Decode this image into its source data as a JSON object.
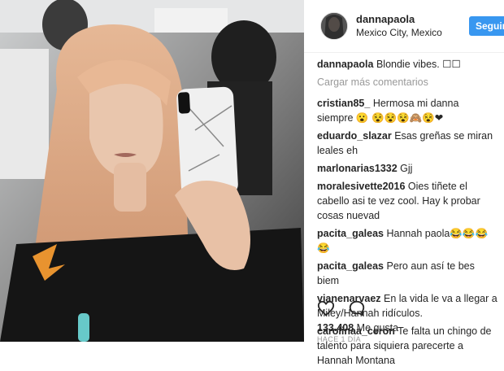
{
  "post": {
    "username": "dannapaola",
    "location": "Mexico City, Mexico",
    "follow_label": "Seguir"
  },
  "caption": {
    "username": "dannapaola",
    "text": "Blondie vibes. ☐☐"
  },
  "load_more_label": "Cargar más comentarios",
  "comments": [
    {
      "user": "cristian85_",
      "text": "Hermosa mi danna siempre 😮 😵😵😵🙈😵❤"
    },
    {
      "user": "eduardo_slazar",
      "text": "Esas greñas se miran leales eh"
    },
    {
      "user": "marlonarias1332",
      "text": "Gjj"
    },
    {
      "user": "moralesivette2016",
      "text": "Oies tiñete el cabello asi te vez cool. Hay k probar cosas nuevad"
    },
    {
      "user": "pacita_galeas",
      "text": "Hannah paola😂😂😂😂"
    },
    {
      "user": "pacita_galeas",
      "text": "Pero aun así te bes biem"
    },
    {
      "user": "vianenarvaez",
      "text": "En la vida le va a llegar a Miley/Hannah ridículos."
    },
    {
      "user": "carolinaa_ceron",
      "text": "Te falta un chingo de talento para siquiera parecerte a Hannah Montana"
    }
  ],
  "likes": {
    "count": "133.408",
    "label": "Me gusta"
  },
  "date": "HACE 1 DÍA",
  "icons": {
    "like": "heart-icon",
    "comment": "comment-bubble-icon"
  },
  "colors": {
    "follow_button": "#3897f0",
    "hair": "#d9a37f"
  }
}
